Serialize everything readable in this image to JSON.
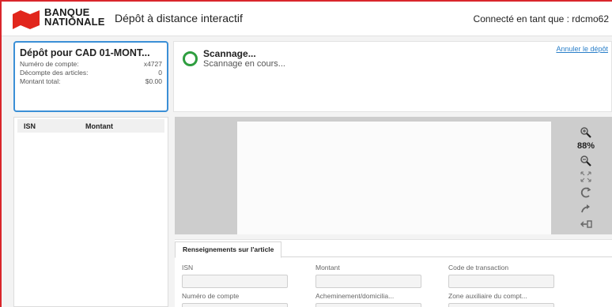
{
  "header": {
    "brand_line1": "BANQUE",
    "brand_line2": "NATIONALE",
    "app_title": "Dépôt à distance interactif",
    "user_status": "Connecté en tant que : rdcmo62"
  },
  "deposit": {
    "title": "Dépôt pour CAD 01-MONT...",
    "rows": [
      {
        "label": "Numéro de compte:",
        "value": "x4727"
      },
      {
        "label": "Décompte des articles:",
        "value": "0"
      },
      {
        "label": "Montant total:",
        "value": "$0.00"
      }
    ]
  },
  "list": {
    "col_isn": "ISN",
    "col_amount": "Montant"
  },
  "scan": {
    "title": "Scannage...",
    "subtitle": "Scannage en cours...",
    "cancel_label": "Annuler le dépôt"
  },
  "viewer": {
    "zoom_label": "88%",
    "tools": [
      "zoom-in-icon",
      "zoom-out-icon",
      "fit-to-screen-icon",
      "rotate-icon",
      "flip-icon",
      "switch-side-icon"
    ]
  },
  "article": {
    "tab_label": "Renseignements sur l'article",
    "fields": [
      {
        "label": "ISN",
        "value": ""
      },
      {
        "label": "Montant",
        "value": ""
      },
      {
        "label": "Code de transaction",
        "value": ""
      },
      {
        "label": "Numéro de compte",
        "value": ""
      },
      {
        "label": "Acheminement/domicilia...",
        "value": ""
      },
      {
        "label": "Zone auxiliaire du compt...",
        "value": ""
      }
    ]
  },
  "colors": {
    "accent_red": "#d9262b",
    "selection_blue": "#3b8fd6",
    "spinner_green": "#2e9e3f",
    "link_blue": "#2a7fc9"
  }
}
